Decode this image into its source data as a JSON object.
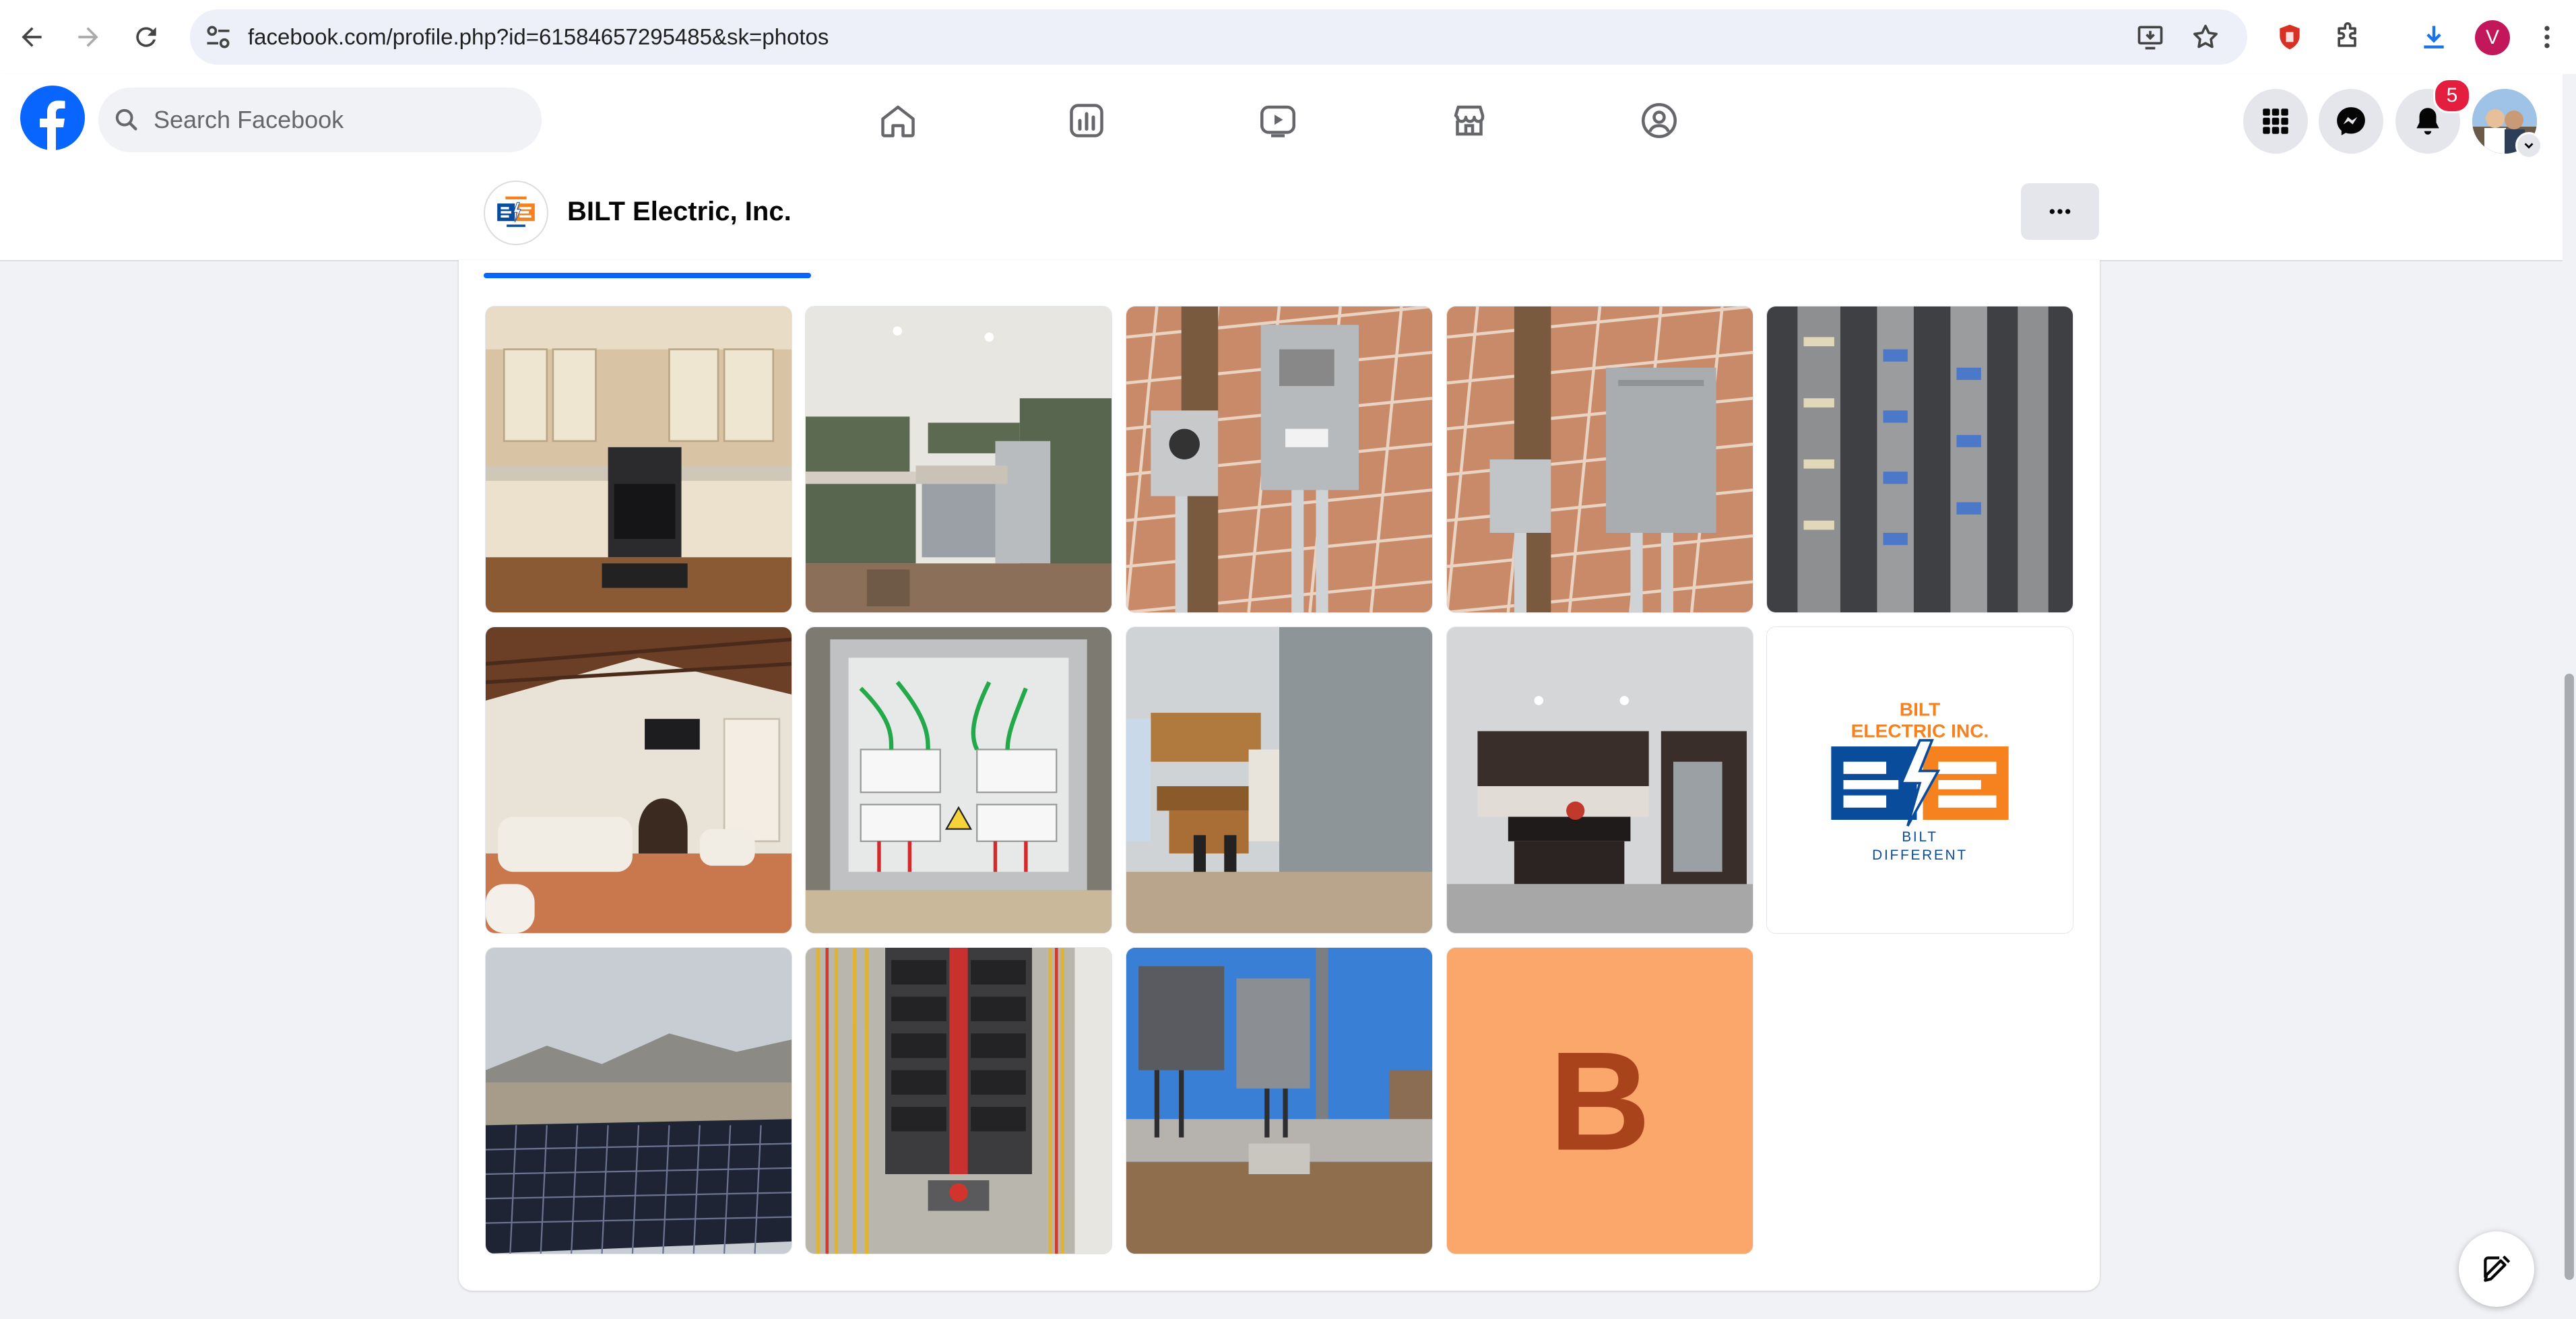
{
  "browser": {
    "url": "facebook.com/profile.php?id=61584657295485&sk=photos",
    "profile_initial": "V"
  },
  "facebook": {
    "search_placeholder": "Search Facebook",
    "notification_count": "5",
    "brand_color": "#0866ff"
  },
  "page": {
    "name": "BILT Electric, Inc.",
    "logo_text": {
      "line1": "BILT",
      "line2": "ELECTRIC INC.",
      "line3": "BILT",
      "line4": "DIFFERENT"
    },
    "placeholder_tile_letter": "B"
  },
  "photos": [
    {
      "subject": "kitchen-cream-cabinets"
    },
    {
      "subject": "kitchen-green-cabinets"
    },
    {
      "subject": "meter-and-breaker-box"
    },
    {
      "subject": "outdoor-disconnect-boxes"
    },
    {
      "subject": "server-panel-wiring"
    },
    {
      "subject": "living-room-fireplace"
    },
    {
      "subject": "solar-combiner-box"
    },
    {
      "subject": "kitchen-wood-cabinets"
    },
    {
      "subject": "kitchen-dark-cabinets"
    },
    {
      "subject": "company-logo"
    },
    {
      "subject": "solar-panel-array"
    },
    {
      "subject": "breaker-panel-wiring"
    },
    {
      "subject": "outdoor-electrical-install"
    },
    {
      "subject": "letter-placeholder"
    }
  ]
}
